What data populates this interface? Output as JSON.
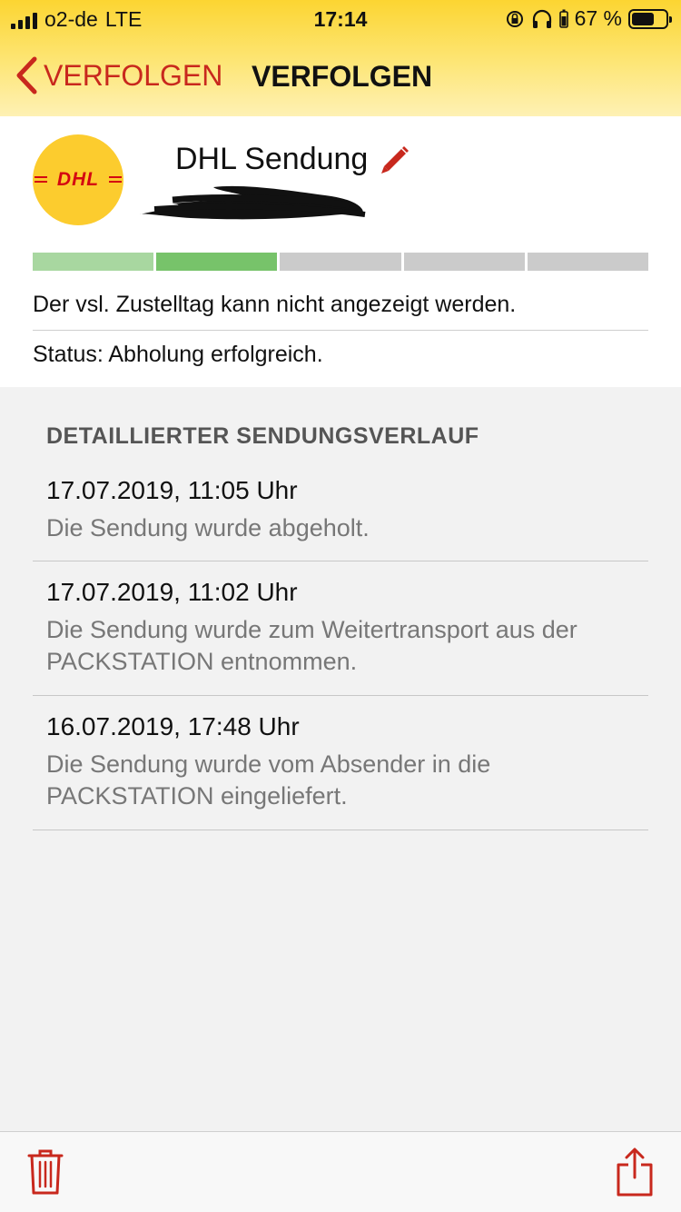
{
  "status_bar": {
    "carrier": "o2-de",
    "network": "LTE",
    "time": "17:14",
    "battery_percent": "67 %",
    "battery_level": 0.67
  },
  "nav": {
    "back_label": "VERFOLGEN",
    "title": "VERFOLGEN"
  },
  "shipment": {
    "logo_text": "DHL",
    "title": "DHL Sendung",
    "progress_steps_total": 5,
    "progress_steps_done": 2,
    "delivery_day": "Der vsl. Zustelltag kann nicht angezeigt werden.",
    "status": "Status: Abholung erfolgreich."
  },
  "history": {
    "heading": "DETAILLIERTER SENDUNGSVERLAUF",
    "events": [
      {
        "date": "17.07.2019, 11:05 Uhr",
        "text": "Die Sendung wurde abgeholt."
      },
      {
        "date": "17.07.2019, 11:02 Uhr",
        "text": "Die Sendung wurde zum Weitertransport aus der PACKSTATION entnommen."
      },
      {
        "date": "16.07.2019, 17:48 Uhr",
        "text": "Die Sendung wurde vom Absender in die PACKSTATION eingeliefert."
      }
    ]
  },
  "icons": {
    "back": "chevron-left-icon",
    "edit": "pencil-icon",
    "delete": "trash-icon",
    "share": "share-icon"
  },
  "colors": {
    "accent_red": "#c8281d",
    "header_yellow": "#fcd531",
    "progress_done_1": "#a8d7a0",
    "progress_done_2": "#77c36a",
    "progress_pending": "#cbcbcb"
  }
}
